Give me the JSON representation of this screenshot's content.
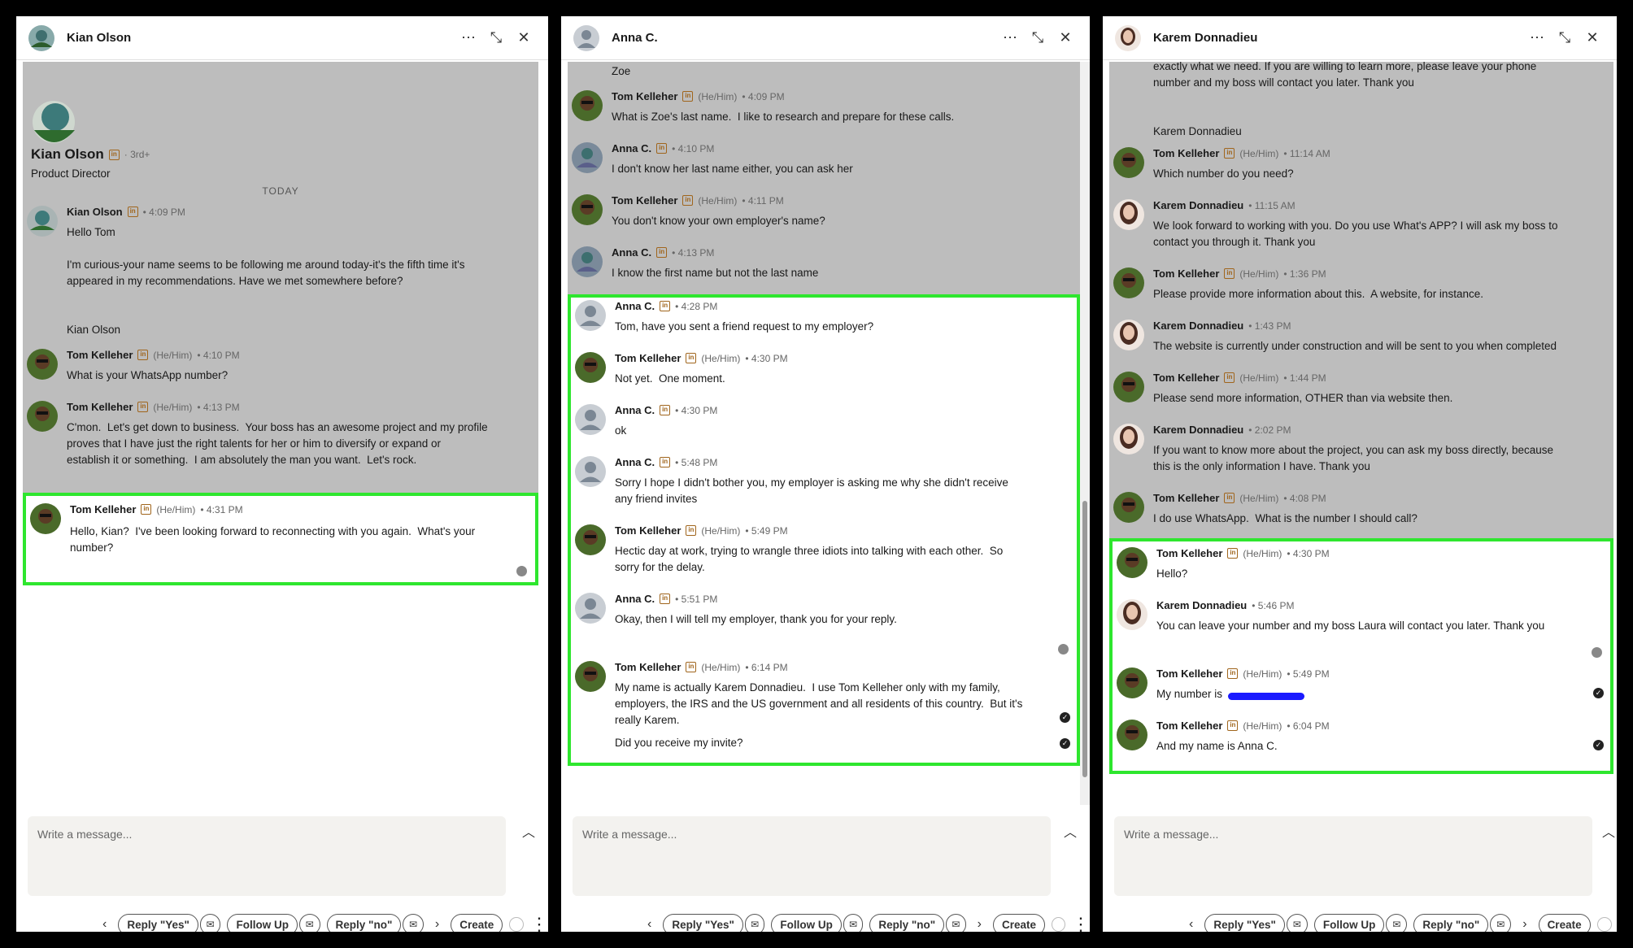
{
  "compose_placeholder": "Write a message...",
  "footer": {
    "reply_yes": "Reply \"Yes\"",
    "follow_up": "Follow Up",
    "reply_no": "Reply \"no\"",
    "create": "Create"
  },
  "panel1": {
    "title": "Kian Olson",
    "profile": {
      "name": "Kian Olson",
      "degree": "· 3rd+",
      "headline": "Product Director",
      "date": "TODAY"
    },
    "messages": [
      {
        "name": "Kian Olson",
        "time": "• 4:09 PM",
        "text": "Hello Tom\n\nI'm curious-your name seems to be following me around today-it's the fifth time it's\nappeared in my recommendations. Have we met somewhere before?\n\n\nKian Olson"
      },
      {
        "name": "Tom Kelleher",
        "pron": "(He/Him)",
        "time": "• 4:10 PM",
        "text": "What is your WhatsApp number?"
      },
      {
        "name": "Tom Kelleher",
        "pron": "(He/Him)",
        "time": "• 4:13 PM",
        "text": "C'mon.  Let's get down to business.  Your boss has an awesome project and my profile\nproves that I have just the right talents for her or him to diversify or expand or\nestablish it or something.  I am absolutely the man you want.  Let's rock."
      },
      {
        "name": "Tom Kelleher",
        "pron": "(He/Him)",
        "time": "• 4:31 PM",
        "text": "Hello, Kian?  I've been looking forward to reconnecting with you again.  What's your\nnumber?"
      }
    ]
  },
  "panel2": {
    "title": "Anna C.",
    "top_fragment": "Zoe",
    "messages": [
      {
        "name": "Tom Kelleher",
        "pron": "(He/Him)",
        "time": "• 4:09 PM",
        "text": "What is Zoe's last name.  I like to research and prepare for these calls."
      },
      {
        "name": "Anna C.",
        "time": "• 4:10 PM",
        "text": "I don't know her last name either, you can ask her"
      },
      {
        "name": "Tom Kelleher",
        "pron": "(He/Him)",
        "time": "• 4:11 PM",
        "text": "You don't know your own employer's name?"
      },
      {
        "name": "Anna C.",
        "time": "• 4:13 PM",
        "text": "I know the first name but not the last name"
      },
      {
        "name": "Anna C.",
        "time": "• 4:28 PM",
        "text": "Tom, have you sent a friend request to my employer?"
      },
      {
        "name": "Tom Kelleher",
        "pron": "(He/Him)",
        "time": "• 4:30 PM",
        "text": "Not yet.  One moment."
      },
      {
        "name": "Anna C.",
        "time": "• 4:30 PM",
        "text": "ok"
      },
      {
        "name": "Anna C.",
        "time": "• 5:48 PM",
        "text": "Sorry I hope I didn't bother you, my employer is asking me why she didn't receive\nany friend invites"
      },
      {
        "name": "Tom Kelleher",
        "pron": "(He/Him)",
        "time": "• 5:49 PM",
        "text": "Hectic day at work, trying to wrangle three idiots into talking with each other.  So\nsorry for the delay."
      },
      {
        "name": "Anna C.",
        "time": "• 5:51 PM",
        "text": "Okay, then I will tell my employer, thank you for your reply."
      },
      {
        "name": "Tom Kelleher",
        "pron": "(He/Him)",
        "time": "• 6:14 PM",
        "text": "My name is actually Karem Donnadieu.  I use Tom Kelleher only with my family,\nemployers, the IRS and the US government and all residents of this country.  But it's\nreally Karem."
      },
      {
        "text": "Did you receive my invite?"
      }
    ]
  },
  "panel3": {
    "title": "Karem Donnadieu",
    "top_fragment": "exactly what we need. If you are willing to learn more, please leave your phone\nnumber and my boss will contact you later. Thank you\n\n\nKarem Donnadieu",
    "messages": [
      {
        "name": "Tom Kelleher",
        "pron": "(He/Him)",
        "time": "• 11:14 AM",
        "text": "Which number do you need?"
      },
      {
        "name": "Karem Donnadieu",
        "time": "• 11:15 AM",
        "text": "We look forward to working with you. Do you use What's APP? I will ask my boss to\ncontact you through it. Thank you"
      },
      {
        "name": "Tom Kelleher",
        "pron": "(He/Him)",
        "time": "• 1:36 PM",
        "text": "Please provide more information about this.  A website, for instance."
      },
      {
        "name": "Karem Donnadieu",
        "time": "• 1:43 PM",
        "text": "The website is currently under construction and will be sent to you when completed"
      },
      {
        "name": "Tom Kelleher",
        "pron": "(He/Him)",
        "time": "• 1:44 PM",
        "text": "Please send more information, OTHER than via website then."
      },
      {
        "name": "Karem Donnadieu",
        "time": "• 2:02 PM",
        "text": "If you want to know more about the project, you can ask my boss directly, because\nthis is the only information I have. Thank you"
      },
      {
        "name": "Tom Kelleher",
        "pron": "(He/Him)",
        "time": "• 4:08 PM",
        "text": "I do use WhatsApp.  What is the number I should call?"
      },
      {
        "name": "Tom Kelleher",
        "pron": "(He/Him)",
        "time": "• 4:30 PM",
        "text": "Hello?"
      },
      {
        "name": "Karem Donnadieu",
        "time": "• 5:46 PM",
        "text": "You can leave your number and my boss Laura will contact you later. Thank you"
      },
      {
        "name": "Tom Kelleher",
        "pron": "(He/Him)",
        "time": "• 5:49 PM",
        "text": "My number is"
      },
      {
        "name": "Tom Kelleher",
        "pron": "(He/Him)",
        "time": "• 6:04 PM",
        "text": "And my name is Anna C."
      }
    ]
  }
}
